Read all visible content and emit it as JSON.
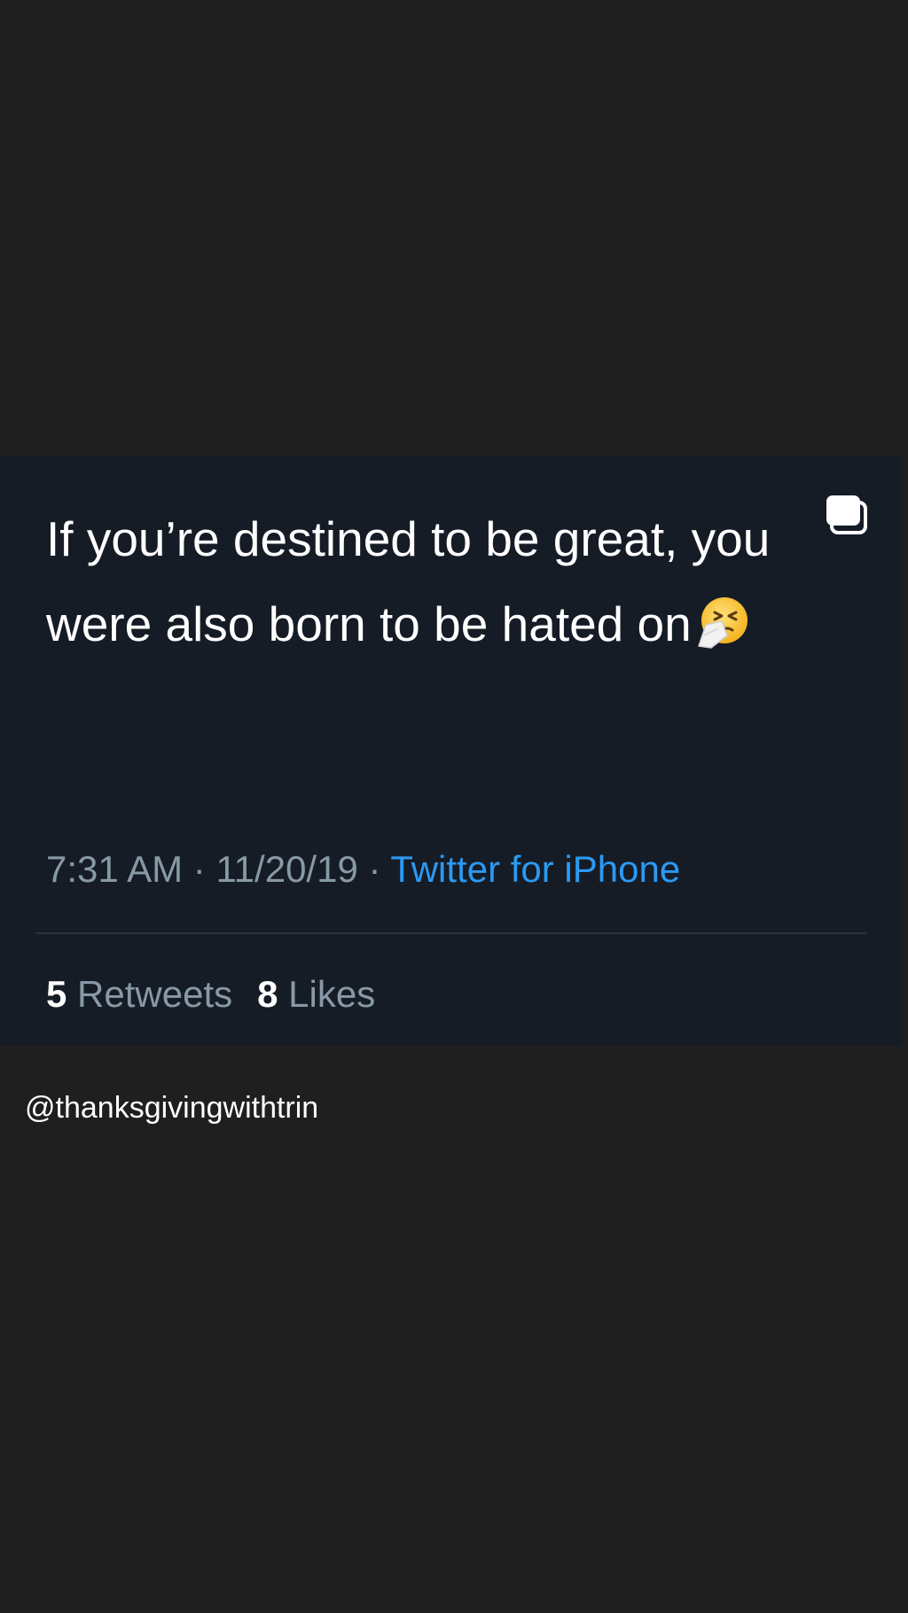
{
  "tweet": {
    "text": "If you’re destined to be great, you were also born to be hated on",
    "emoji_icon": "sneezing-face-emoji",
    "time": "7:31 AM",
    "separator": " · ",
    "date": "11/20/19",
    "source": "Twitter for iPhone",
    "retweets_count": "5",
    "retweets_label": "Retweets",
    "likes_count": "8",
    "likes_label": "Likes",
    "corner_icon": "copy-icon"
  },
  "watermark": {
    "handle": "@thanksgivingwithtrin"
  },
  "colors": {
    "page_background": "#1f1f1f",
    "card_background": "#161c26",
    "text_primary": "#ffffff",
    "text_secondary": "#8899a6",
    "link": "#2b9af3",
    "divider": "#2a323d"
  }
}
